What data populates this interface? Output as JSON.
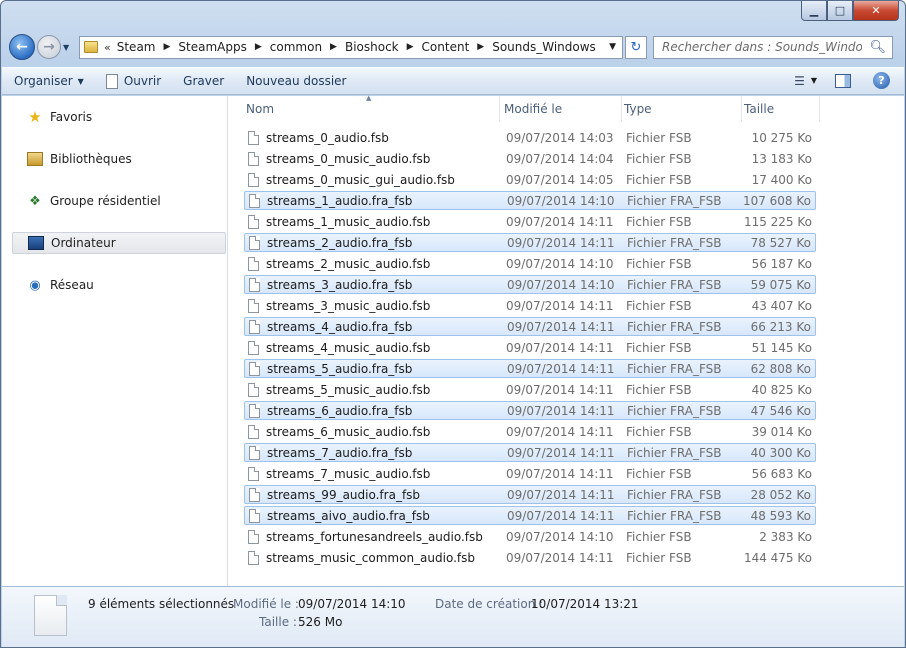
{
  "window": {
    "minimize": "▁",
    "maximize": "□",
    "close": "✕"
  },
  "nav": {
    "back_icon": "arrow-left-icon",
    "forward_icon": "arrow-right-icon"
  },
  "address": {
    "chevron": "«",
    "crumbs": [
      "Steam",
      "SteamApps",
      "common",
      "Bioshock",
      "Content",
      "Sounds_Windows"
    ],
    "separator": "▶"
  },
  "search": {
    "placeholder": "Rechercher dans : Sounds_Windows"
  },
  "toolbar": {
    "organize": "Organiser",
    "open": "Ouvrir",
    "burn": "Graver",
    "new_folder": "Nouveau dossier"
  },
  "sidebar": {
    "items": [
      {
        "label": "Favoris",
        "icon": "star-icon"
      },
      {
        "label": "Bibliothèques",
        "icon": "library-icon"
      },
      {
        "label": "Groupe résidentiel",
        "icon": "homegroup-icon"
      },
      {
        "label": "Ordinateur",
        "icon": "computer-icon",
        "selected": true
      },
      {
        "label": "Réseau",
        "icon": "network-icon"
      }
    ]
  },
  "columns": {
    "name": "Nom",
    "modified": "Modifié le",
    "type": "Type",
    "size": "Taille"
  },
  "files": [
    {
      "name": "streams_0_audio.fsb",
      "modified": "09/07/2014 14:03",
      "type": "Fichier FSB",
      "size": "10 275 Ko",
      "selected": false
    },
    {
      "name": "streams_0_music_audio.fsb",
      "modified": "09/07/2014 14:04",
      "type": "Fichier FSB",
      "size": "13 183 Ko",
      "selected": false
    },
    {
      "name": "streams_0_music_gui_audio.fsb",
      "modified": "09/07/2014 14:05",
      "type": "Fichier FSB",
      "size": "17 400 Ko",
      "selected": false
    },
    {
      "name": "streams_1_audio.fra_fsb",
      "modified": "09/07/2014 14:10",
      "type": "Fichier FRA_FSB",
      "size": "107 608 Ko",
      "selected": true
    },
    {
      "name": "streams_1_music_audio.fsb",
      "modified": "09/07/2014 14:11",
      "type": "Fichier FSB",
      "size": "115 225 Ko",
      "selected": false
    },
    {
      "name": "streams_2_audio.fra_fsb",
      "modified": "09/07/2014 14:11",
      "type": "Fichier FRA_FSB",
      "size": "78 527 Ko",
      "selected": true
    },
    {
      "name": "streams_2_music_audio.fsb",
      "modified": "09/07/2014 14:10",
      "type": "Fichier FSB",
      "size": "56 187 Ko",
      "selected": false
    },
    {
      "name": "streams_3_audio.fra_fsb",
      "modified": "09/07/2014 14:10",
      "type": "Fichier FRA_FSB",
      "size": "59 075 Ko",
      "selected": true
    },
    {
      "name": "streams_3_music_audio.fsb",
      "modified": "09/07/2014 14:11",
      "type": "Fichier FSB",
      "size": "43 407 Ko",
      "selected": false
    },
    {
      "name": "streams_4_audio.fra_fsb",
      "modified": "09/07/2014 14:11",
      "type": "Fichier FRA_FSB",
      "size": "66 213 Ko",
      "selected": true
    },
    {
      "name": "streams_4_music_audio.fsb",
      "modified": "09/07/2014 14:11",
      "type": "Fichier FSB",
      "size": "51 145 Ko",
      "selected": false
    },
    {
      "name": "streams_5_audio.fra_fsb",
      "modified": "09/07/2014 14:11",
      "type": "Fichier FRA_FSB",
      "size": "62 808 Ko",
      "selected": true
    },
    {
      "name": "streams_5_music_audio.fsb",
      "modified": "09/07/2014 14:11",
      "type": "Fichier FSB",
      "size": "40 825 Ko",
      "selected": false
    },
    {
      "name": "streams_6_audio.fra_fsb",
      "modified": "09/07/2014 14:11",
      "type": "Fichier FRA_FSB",
      "size": "47 546 Ko",
      "selected": true
    },
    {
      "name": "streams_6_music_audio.fsb",
      "modified": "09/07/2014 14:11",
      "type": "Fichier FSB",
      "size": "39 014 Ko",
      "selected": false
    },
    {
      "name": "streams_7_audio.fra_fsb",
      "modified": "09/07/2014 14:11",
      "type": "Fichier FRA_FSB",
      "size": "40 300 Ko",
      "selected": true
    },
    {
      "name": "streams_7_music_audio.fsb",
      "modified": "09/07/2014 14:11",
      "type": "Fichier FSB",
      "size": "56 683 Ko",
      "selected": false
    },
    {
      "name": "streams_99_audio.fra_fsb",
      "modified": "09/07/2014 14:11",
      "type": "Fichier FRA_FSB",
      "size": "28 052 Ko",
      "selected": true
    },
    {
      "name": "streams_aivo_audio.fra_fsb",
      "modified": "09/07/2014 14:11",
      "type": "Fichier FRA_FSB",
      "size": "48 593 Ko",
      "selected": true
    },
    {
      "name": "streams_fortunesandreels_audio.fsb",
      "modified": "09/07/2014 14:10",
      "type": "Fichier FSB",
      "size": "2 383 Ko",
      "selected": false
    },
    {
      "name": "streams_music_common_audio.fsb",
      "modified": "09/07/2014 14:11",
      "type": "Fichier FSB",
      "size": "144 475 Ko",
      "selected": false
    }
  ],
  "details": {
    "count": "9 éléments sélectionnés",
    "modified_label": "Modifié le :",
    "modified_value": "09/07/2014 14:10",
    "created_label": "Date de création :",
    "created_value": "10/07/2014 13:21",
    "size_label": "Taille :",
    "size_value": "526 Mo"
  },
  "colors": {
    "selection": "#d7e7fb",
    "selection_border": "#9ec2ea",
    "chrome": "#bcd1ea"
  }
}
